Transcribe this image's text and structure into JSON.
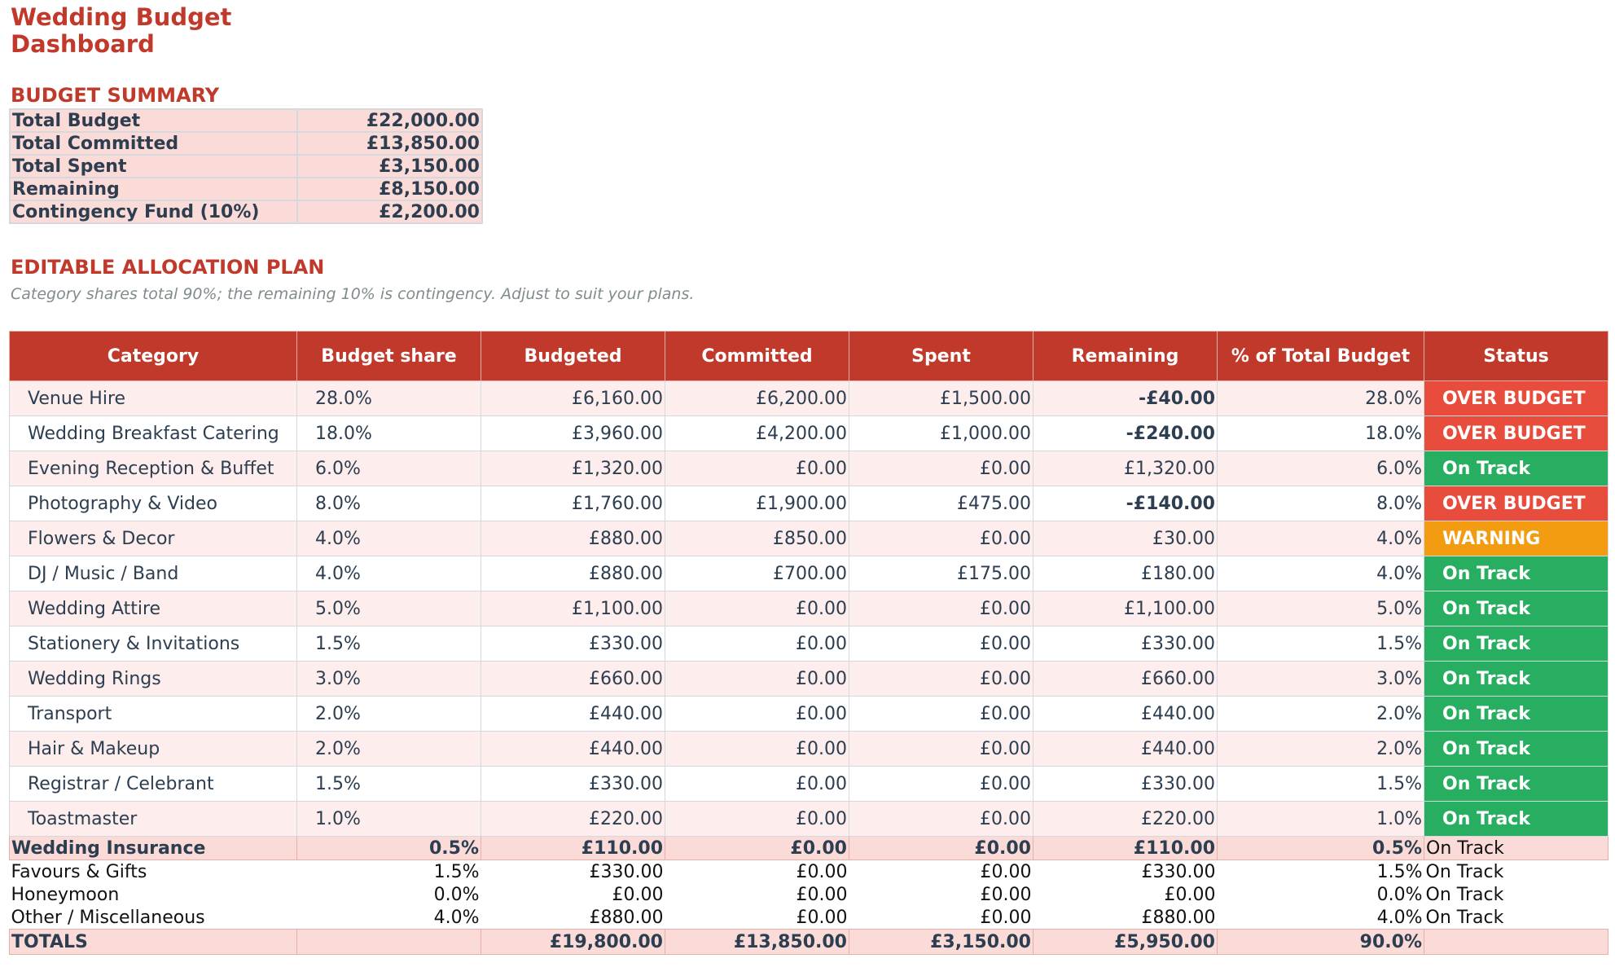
{
  "title": "Wedding Budget Dashboard",
  "summary": {
    "heading": "BUDGET SUMMARY",
    "rows": [
      {
        "label": "Total Budget",
        "value": "£22,000.00"
      },
      {
        "label": "Total Committed",
        "value": "£13,850.00"
      },
      {
        "label": "Total Spent",
        "value": "£3,150.00"
      },
      {
        "label": "Remaining",
        "value": "£8,150.00"
      },
      {
        "label": "Contingency Fund (10%)",
        "value": "£2,200.00"
      }
    ]
  },
  "allocation": {
    "heading": "EDITABLE ALLOCATION PLAN",
    "note": "Category shares total 90%; the remaining 10% is contingency. Adjust to suit your plans.",
    "columns": [
      "Category",
      "Budget share",
      "Budgeted",
      "Committed",
      "Spent",
      "Remaining",
      "% of Total Budget",
      "Status"
    ],
    "rows": [
      {
        "category": "Venue Hire",
        "share": "28.0%",
        "budgeted": "£6,160.00",
        "committed": "£6,200.00",
        "spent": "£1,500.00",
        "remaining": "-£40.00",
        "pct": "28.0%",
        "status": "OVER BUDGET"
      },
      {
        "category": "Wedding Breakfast Catering",
        "share": "18.0%",
        "budgeted": "£3,960.00",
        "committed": "£4,200.00",
        "spent": "£1,000.00",
        "remaining": "-£240.00",
        "pct": "18.0%",
        "status": "OVER BUDGET"
      },
      {
        "category": "Evening Reception & Buffet",
        "share": "6.0%",
        "budgeted": "£1,320.00",
        "committed": "£0.00",
        "spent": "£0.00",
        "remaining": "£1,320.00",
        "pct": "6.0%",
        "status": "On Track"
      },
      {
        "category": "Photography & Video",
        "share": "8.0%",
        "budgeted": "£1,760.00",
        "committed": "£1,900.00",
        "spent": "£475.00",
        "remaining": "-£140.00",
        "pct": "8.0%",
        "status": "OVER BUDGET"
      },
      {
        "category": "Flowers & Decor",
        "share": "4.0%",
        "budgeted": "£880.00",
        "committed": "£850.00",
        "spent": "£0.00",
        "remaining": "£30.00",
        "pct": "4.0%",
        "status": "WARNING"
      },
      {
        "category": "DJ / Music / Band",
        "share": "4.0%",
        "budgeted": "£880.00",
        "committed": "£700.00",
        "spent": "£175.00",
        "remaining": "£180.00",
        "pct": "4.0%",
        "status": "On Track"
      },
      {
        "category": "Wedding Attire",
        "share": "5.0%",
        "budgeted": "£1,100.00",
        "committed": "£0.00",
        "spent": "£0.00",
        "remaining": "£1,100.00",
        "pct": "5.0%",
        "status": "On Track"
      },
      {
        "category": "Stationery & Invitations",
        "share": "1.5%",
        "budgeted": "£330.00",
        "committed": "£0.00",
        "spent": "£0.00",
        "remaining": "£330.00",
        "pct": "1.5%",
        "status": "On Track"
      },
      {
        "category": "Wedding Rings",
        "share": "3.0%",
        "budgeted": "£660.00",
        "committed": "£0.00",
        "spent": "£0.00",
        "remaining": "£660.00",
        "pct": "3.0%",
        "status": "On Track"
      },
      {
        "category": "Transport",
        "share": "2.0%",
        "budgeted": "£440.00",
        "committed": "£0.00",
        "spent": "£0.00",
        "remaining": "£440.00",
        "pct": "2.0%",
        "status": "On Track"
      },
      {
        "category": "Hair & Makeup",
        "share": "2.0%",
        "budgeted": "£440.00",
        "committed": "£0.00",
        "spent": "£0.00",
        "remaining": "£440.00",
        "pct": "2.0%",
        "status": "On Track"
      },
      {
        "category": "Registrar / Celebrant",
        "share": "1.5%",
        "budgeted": "£330.00",
        "committed": "£0.00",
        "spent": "£0.00",
        "remaining": "£330.00",
        "pct": "1.5%",
        "status": "On Track"
      },
      {
        "category": "Toastmaster",
        "share": "1.0%",
        "budgeted": "£220.00",
        "committed": "£0.00",
        "spent": "£0.00",
        "remaining": "£220.00",
        "pct": "1.0%",
        "status": "On Track"
      }
    ],
    "extra_rows": [
      {
        "category": "Wedding Insurance",
        "share": "0.5%",
        "budgeted": "£110.00",
        "committed": "£0.00",
        "spent": "£0.00",
        "remaining": "£110.00",
        "pct": "0.5%",
        "status": "On Track"
      },
      {
        "category": "Favours & Gifts",
        "share": "1.5%",
        "budgeted": "£330.00",
        "committed": "£0.00",
        "spent": "£0.00",
        "remaining": "£330.00",
        "pct": "1.5%",
        "status": "On Track"
      },
      {
        "category": "Honeymoon",
        "share": "0.0%",
        "budgeted": "£0.00",
        "committed": "£0.00",
        "spent": "£0.00",
        "remaining": "£0.00",
        "pct": "0.0%",
        "status": "On Track"
      },
      {
        "category": "Other / Miscellaneous",
        "share": "4.0%",
        "budgeted": "£880.00",
        "committed": "£0.00",
        "spent": "£0.00",
        "remaining": "£880.00",
        "pct": "4.0%",
        "status": "On Track"
      }
    ],
    "totals": {
      "label": "TOTALS",
      "budgeted": "£19,800.00",
      "committed": "£13,850.00",
      "spent": "£3,150.00",
      "remaining": "£5,950.00",
      "pct": "90.0%"
    }
  },
  "colors": {
    "accent": "#c0392b",
    "over_budget": "#e74c3c",
    "on_track": "#27ae60",
    "warning": "#f39c12",
    "summary_fill": "#fadbd8"
  }
}
